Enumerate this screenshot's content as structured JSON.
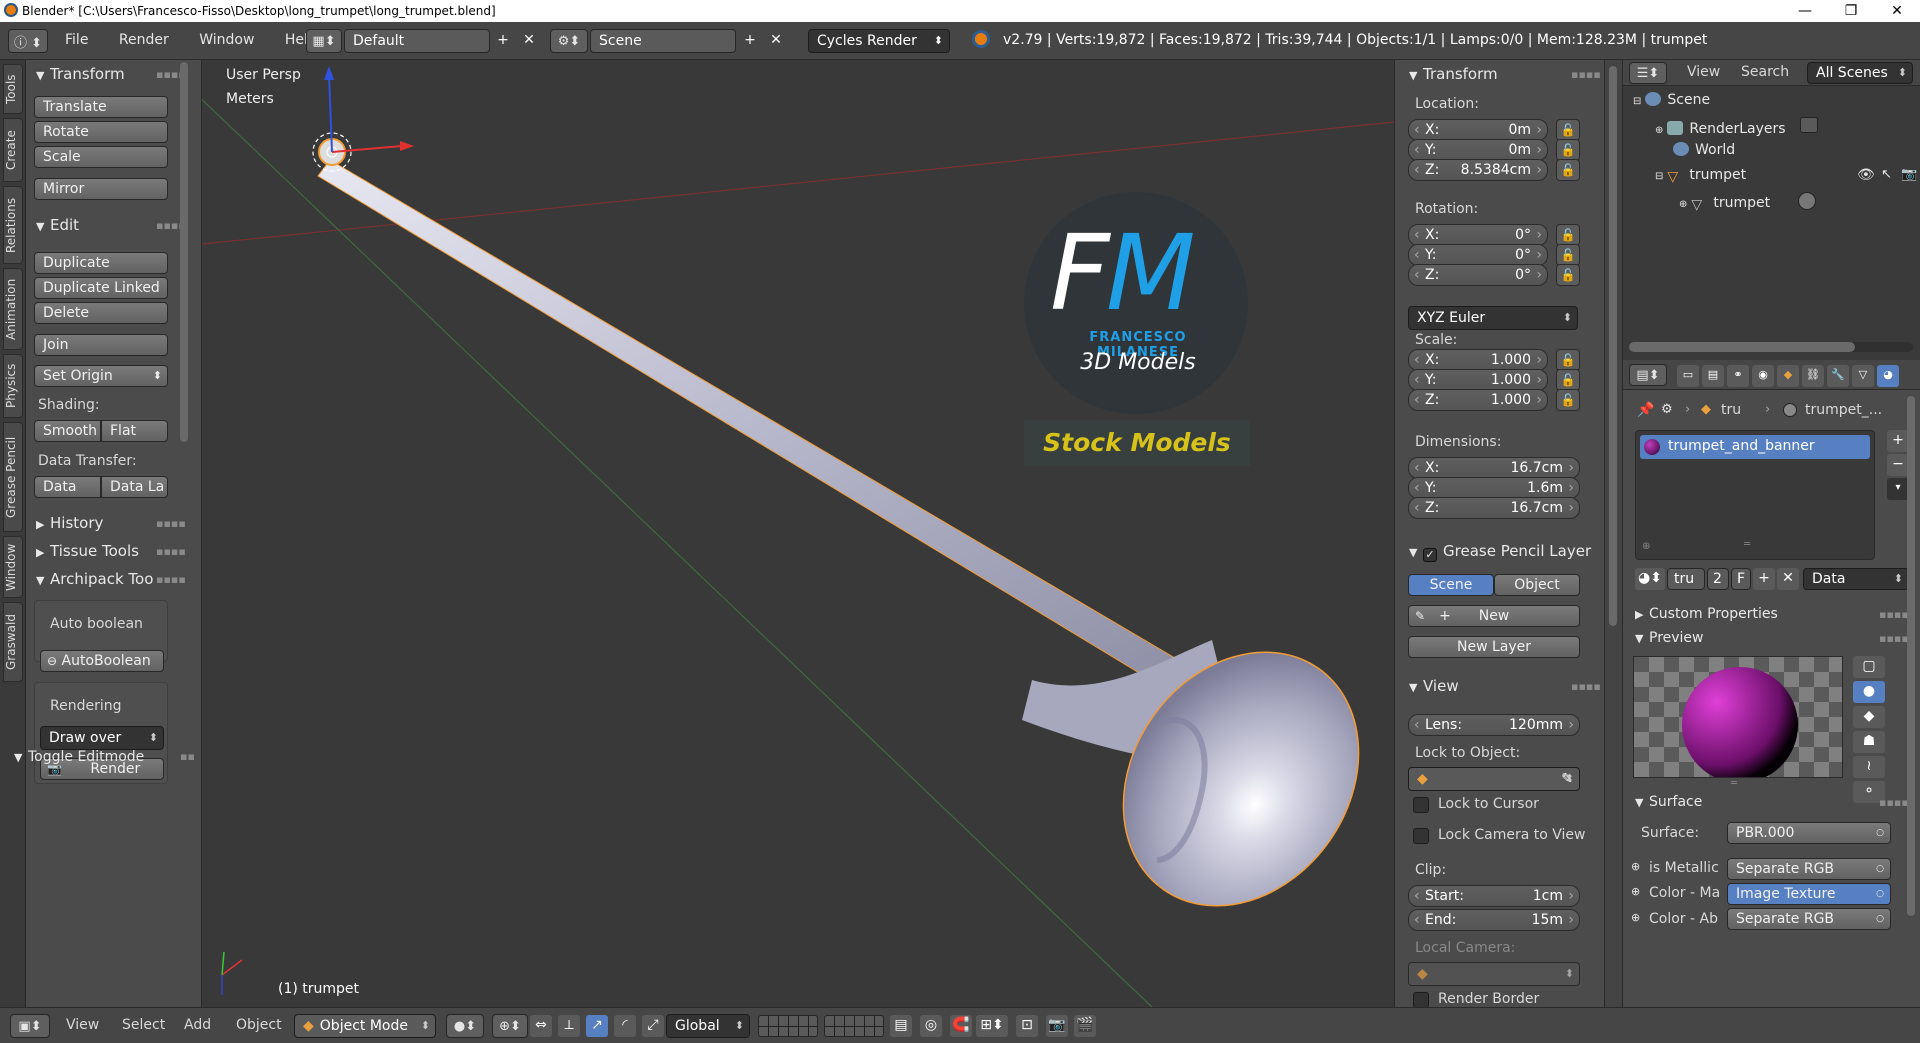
{
  "window": {
    "title": "Blender* [C:\\Users\\Francesco-Fisso\\Desktop\\long_trumpet\\long_trumpet.blend]",
    "controls": [
      "—",
      "❐",
      "✕"
    ]
  },
  "topbar": {
    "menus": [
      "File",
      "Render",
      "Window",
      "Help"
    ],
    "layout": "Default",
    "scene": "Scene",
    "engine": "Cycles Render",
    "stats": "v2.79 | Verts:19,872 | Faces:19,872 | Tris:39,744 | Objects:1/1 | Lamps:0/0 | Mem:128.23M | trumpet"
  },
  "left_tabs": [
    "Tools",
    "Create",
    "Relations",
    "Animation",
    "Physics",
    "Grease Pencil",
    "Window",
    "Graswald"
  ],
  "toolshelf": {
    "transform_title": "Transform",
    "transform_buttons": [
      "Translate",
      "Rotate",
      "Scale",
      "Mirror"
    ],
    "edit_title": "Edit",
    "edit_buttons": [
      "Duplicate",
      "Duplicate Linked",
      "Delete",
      "Join"
    ],
    "set_origin": "Set Origin",
    "shading_label": "Shading:",
    "smooth": "Smooth",
    "flat": "Flat",
    "data_transfer_label": "Data Transfer:",
    "data": "Data",
    "data_la": "Data La",
    "history": "History",
    "tissue_tools": "Tissue Tools",
    "archipack": "Archipack Too",
    "auto_boolean_label": "Auto boolean",
    "autoboolean_button": "AutoBoolean",
    "rendering_label": "Rendering",
    "draw_over": "Draw over",
    "render_button": "Render",
    "toggle_editmode": "Toggle Editmode"
  },
  "viewport": {
    "view_name": "User Persp",
    "units": "Meters",
    "object_label": "(1) trumpet",
    "watermark_fm": "FM",
    "watermark_name": "FRANCESCO MILANESE",
    "watermark_sub": "3D Models",
    "watermark_stock": "Stock Models"
  },
  "properties": {
    "transform_title": "Transform",
    "location_label": "Location:",
    "location": [
      {
        "k": "X:",
        "v": "0m"
      },
      {
        "k": "Y:",
        "v": "0m"
      },
      {
        "k": "Z:",
        "v": "8.5384cm"
      }
    ],
    "rotation_label": "Rotation:",
    "rotation": [
      {
        "k": "X:",
        "v": "0°"
      },
      {
        "k": "Y:",
        "v": "0°"
      },
      {
        "k": "Z:",
        "v": "0°"
      }
    ],
    "rotation_mode": "XYZ Euler",
    "scale_label": "Scale:",
    "scale": [
      {
        "k": "X:",
        "v": "1.000"
      },
      {
        "k": "Y:",
        "v": "1.000"
      },
      {
        "k": "Z:",
        "v": "1.000"
      }
    ],
    "dimensions_label": "Dimensions:",
    "dimensions": [
      {
        "k": "X:",
        "v": "16.7cm"
      },
      {
        "k": "Y:",
        "v": "1.6m"
      },
      {
        "k": "Z:",
        "v": "16.7cm"
      }
    ],
    "grease_title": "Grease Pencil Layer",
    "scene_tab": "Scene",
    "object_tab": "Object",
    "new": "New",
    "new_layer": "New Layer",
    "view_title": "View",
    "lens_k": "Lens:",
    "lens_v": "120mm",
    "lock_to_object": "Lock to Object:",
    "lock_to_cursor": "Lock to Cursor",
    "lock_camera": "Lock Camera to View",
    "clip_label": "Clip:",
    "clip_start_k": "Start:",
    "clip_start_v": "1cm",
    "clip_end_k": "End:",
    "clip_end_v": "15m",
    "local_camera": "Local Camera:",
    "render_border": "Render Border"
  },
  "outliner": {
    "view": "View",
    "search": "Search",
    "filter": "All Scenes",
    "items": [
      "Scene",
      "RenderLayers",
      "World",
      "trumpet",
      "trumpet"
    ]
  },
  "material": {
    "breadcrumb_obj": "tru",
    "breadcrumb_mat": "trumpet_...",
    "slot": "trumpet_and_banner",
    "mat_name": "tru",
    "users": "2",
    "fake": "F",
    "link": "Data",
    "custom_properties": "Custom Properties",
    "preview": "Preview",
    "surface_title": "Surface",
    "surface_label": "Surface:",
    "surface_value": "PBR.000",
    "is_metallic": "is Metallic",
    "is_metallic_val": "Separate RGB",
    "color_ma": "Color - Ma",
    "color_ma_val": "Image Texture",
    "color_ab": "Color - Ab",
    "color_ab_val": "Separate RGB"
  },
  "bottombar": {
    "menus": [
      "View",
      "Select",
      "Add",
      "Object"
    ],
    "mode": "Object Mode",
    "orientation": "Global"
  },
  "colors": {
    "accent_blue": "#5680c2",
    "selection_orange": "#f39c35",
    "fm_blue": "#1e9fe6",
    "stock_yellow": "#d7c21a"
  }
}
